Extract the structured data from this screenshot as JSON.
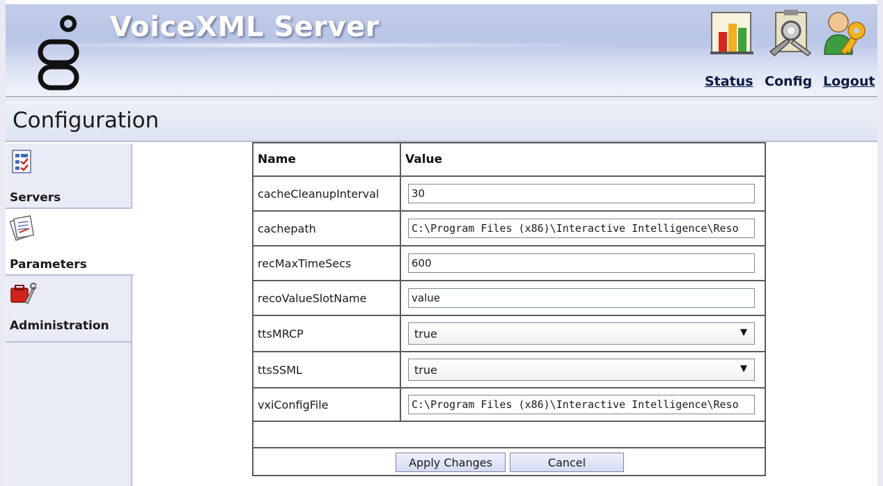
{
  "header": {
    "app_title": "VoiceXML Server",
    "nav": [
      {
        "label": "Status",
        "icon": "status-chart-icon"
      },
      {
        "label": "Config",
        "icon": "config-clipboard-icon"
      },
      {
        "label": "Logout",
        "icon": "logout-user-key-icon"
      }
    ]
  },
  "page": {
    "title": "Configuration"
  },
  "sidebar": {
    "items": [
      {
        "label": "Servers",
        "icon": "servers-checklist-icon"
      },
      {
        "label": "Parameters",
        "icon": "parameters-document-icon"
      },
      {
        "label": "Administration",
        "icon": "administration-toolbox-icon"
      }
    ]
  },
  "table": {
    "headers": {
      "name": "Name",
      "value": "Value"
    },
    "rows": [
      {
        "name": "cacheCleanupInterval",
        "value": "30",
        "type": "text"
      },
      {
        "name": "cachepath",
        "value": "C:\\Program Files (x86)\\Interactive Intelligence\\Reso",
        "type": "text"
      },
      {
        "name": "recMaxTimeSecs",
        "value": "600",
        "type": "text"
      },
      {
        "name": "recoValueSlotName",
        "value": "value",
        "type": "text"
      },
      {
        "name": "ttsMRCP",
        "value": "true",
        "type": "select"
      },
      {
        "name": "ttsSSML",
        "value": "true",
        "type": "select"
      },
      {
        "name": "vxiConfigFile",
        "value": "C:\\Program Files (x86)\\Interactive Intelligence\\Reso",
        "type": "text"
      }
    ],
    "buttons": {
      "apply": "Apply Changes",
      "cancel": "Cancel"
    }
  },
  "colors": {
    "header_bg": "#c3cde9",
    "title_bar_bg": "#e4e8f5",
    "sidebar_bg": "#e9ecf6",
    "link_color": "#0d1a44"
  }
}
